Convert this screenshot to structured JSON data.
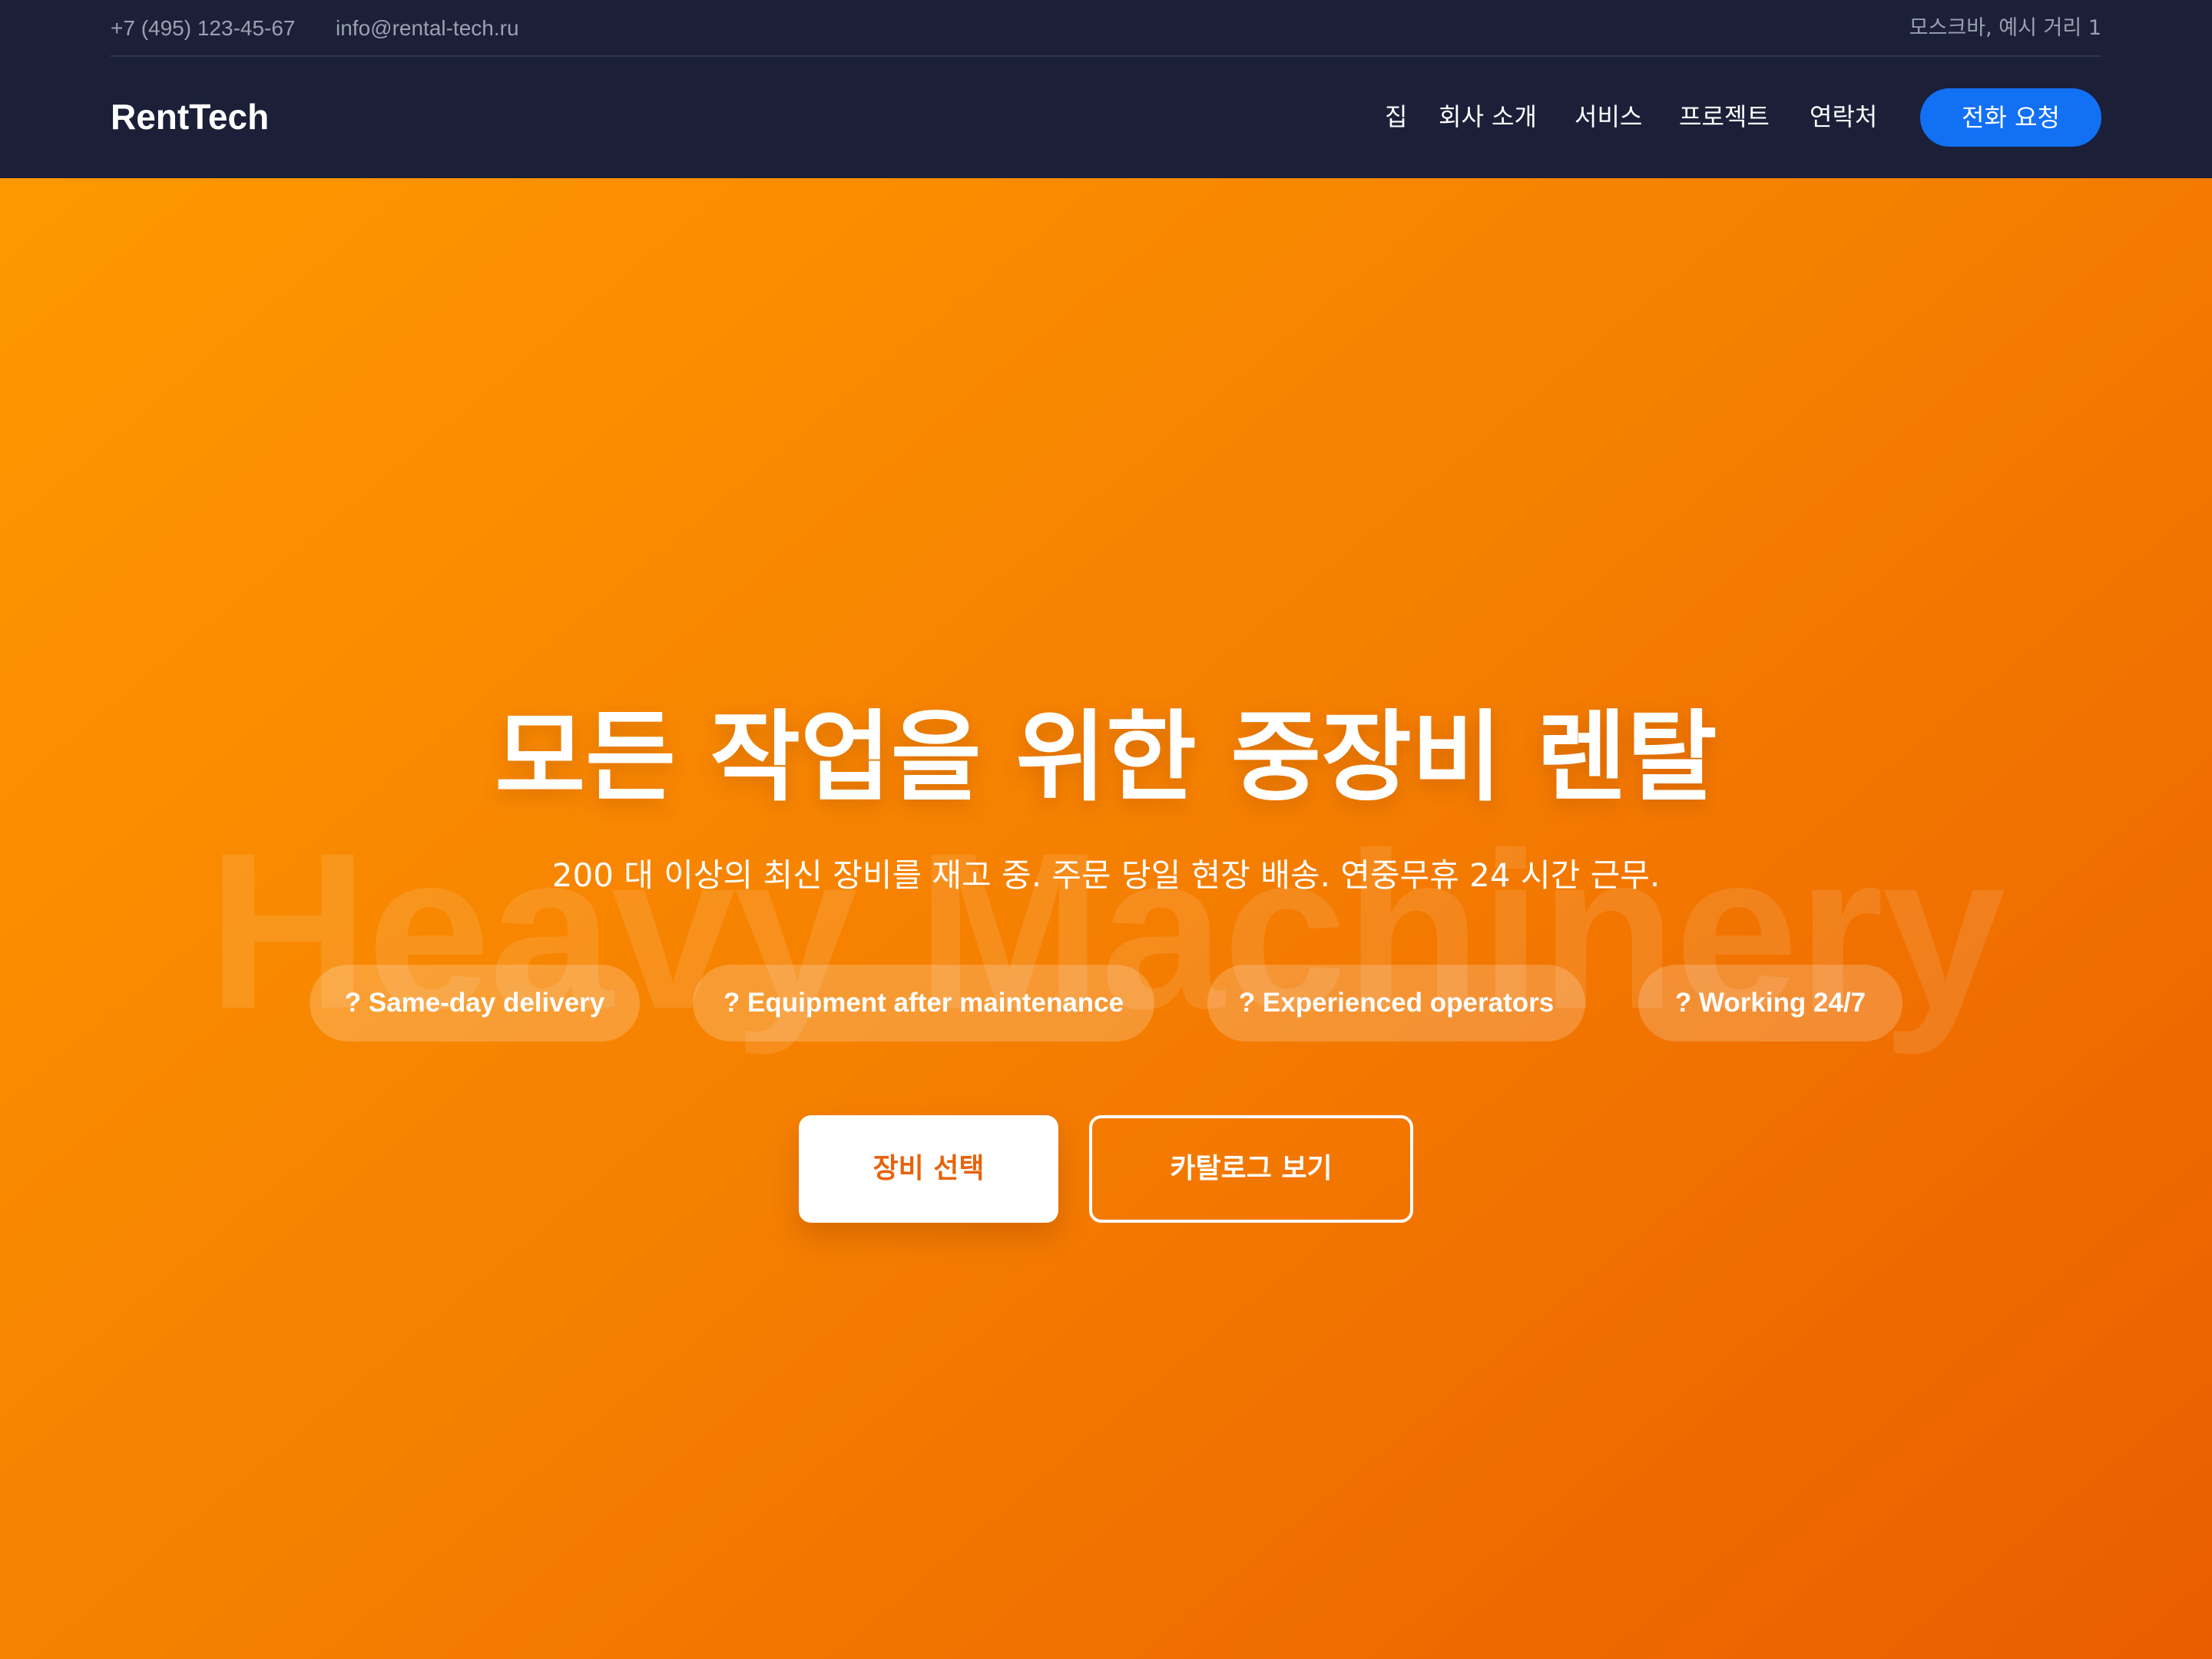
{
  "topbar": {
    "phone": "+7 (495) 123-45-67",
    "email": "info@rental-tech.ru",
    "address": "모스크바, 예시 거리 1"
  },
  "header": {
    "logo": "RentTech",
    "nav": {
      "home": "집",
      "about": "회사 소개",
      "services": "서비스",
      "projects": "프로젝트",
      "contacts": "연락처"
    },
    "call_button": "전화 요청"
  },
  "hero": {
    "watermark": "Heavy Machinery",
    "title": "모든 작업을 위한 중장비 렌탈",
    "subtitle": "200 대 이상의 최신 장비를 재고 중. 주문 당일 현장 배송. 연중무휴 24 시간 근무.",
    "features": [
      "? Same-day delivery",
      "? Equipment after maintenance",
      "? Experienced operators",
      "? Working 24/7"
    ],
    "primary_button": "장비 선택",
    "secondary_button": "카탈로그 보기"
  },
  "colors": {
    "header_bg": "#1b1f38",
    "accent_blue": "#1270f5",
    "hero_gradient_start": "#ff9800",
    "hero_gradient_end": "#ea5d00",
    "primary_button_text": "#e8620a"
  }
}
